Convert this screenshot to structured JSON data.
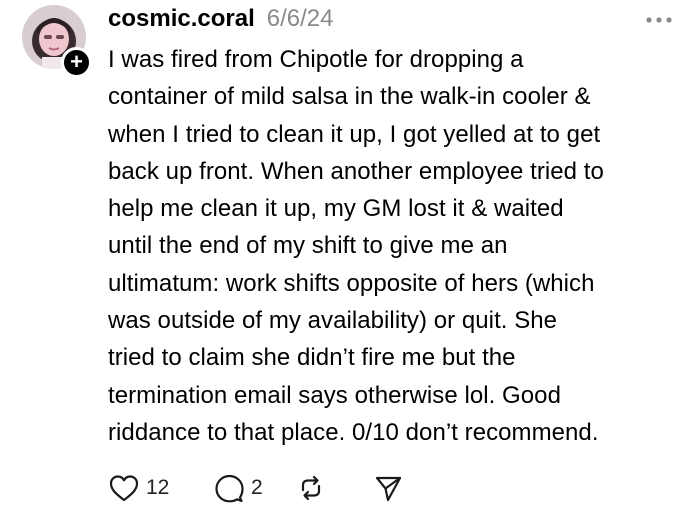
{
  "post": {
    "username": "cosmic.coral",
    "date": "6/6/24",
    "follow_symbol": "+",
    "lines": [
      "I was fired from Chipotle for dropping a",
      "container of mild salsa in the walk-in cooler &",
      "when I tried to clean it up, I got yelled at to get",
      "back up front. When another employee tried to",
      "help me clean it up, my GM lost it & waited",
      "until the end of my shift to give me an",
      "ultimatum: work shifts opposite of hers (which",
      "was outside of my availability) or quit. She",
      "tried to claim she didn’t fire me but the",
      "termination email says otherwise lol. Good",
      "riddance to that place. 0/10 don’t recommend."
    ],
    "likes": "12",
    "replies": "2"
  },
  "icons": {
    "more": "more-horizontal-icon",
    "like": "heart-icon",
    "reply": "comment-bubble-icon",
    "repost": "repost-icon",
    "share": "send-icon"
  },
  "colors": {
    "text": "#000000",
    "meta": "#8a8a8a",
    "icon": "#1a1a1a",
    "badge": "#000000"
  }
}
